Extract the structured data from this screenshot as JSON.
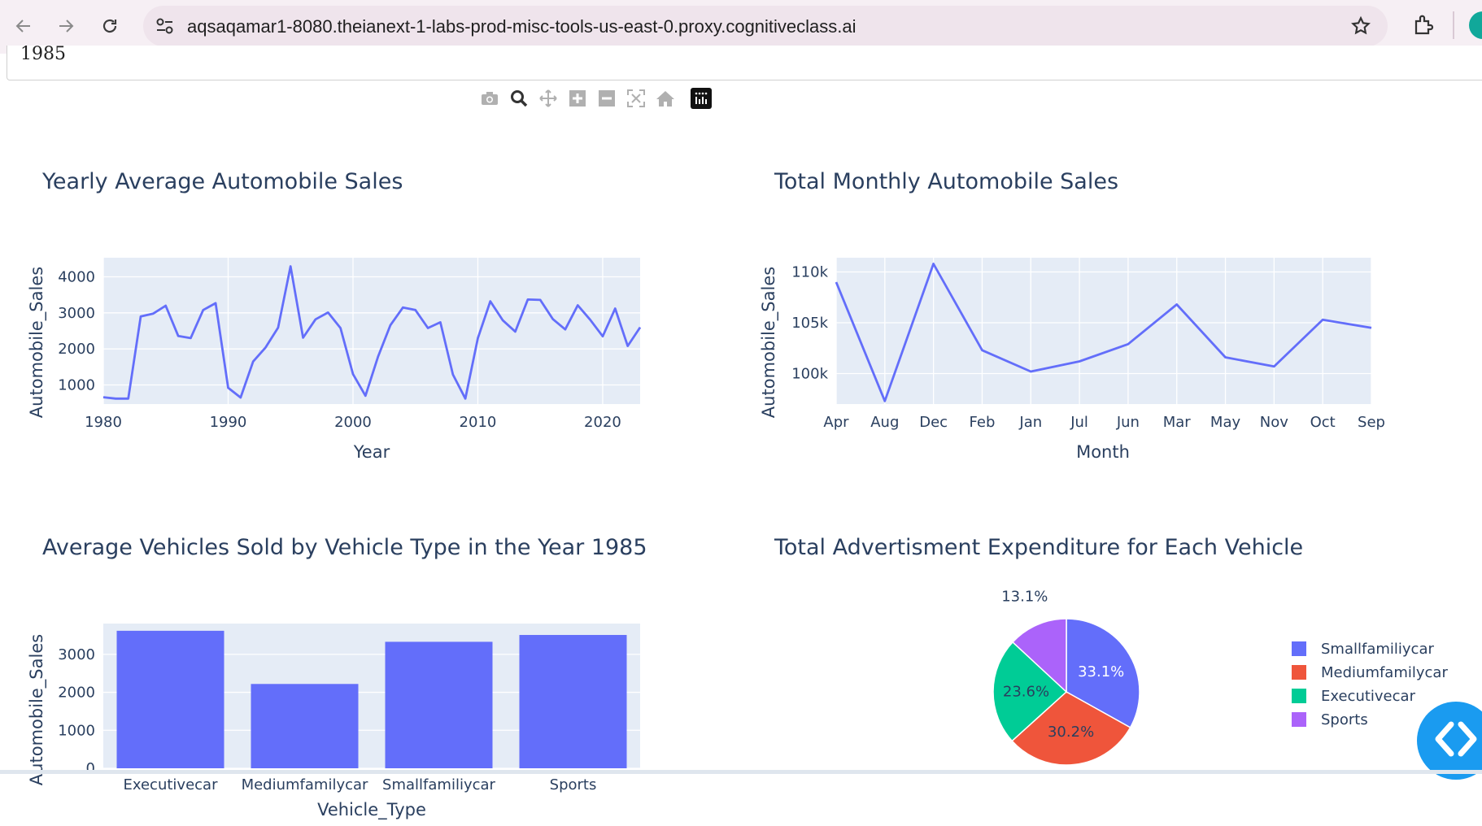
{
  "browser": {
    "url": "aqsaqamar1-8080.theianext-1-labs-prod-misc-tools-us-east-0.proxy.cognitiveclass.ai",
    "icons": [
      "back-arrow-icon",
      "forward-arrow-icon",
      "reload-icon",
      "site-settings-icon",
      "bookmark-star-icon",
      "extensions-icon"
    ]
  },
  "year_input": {
    "value": "1985"
  },
  "modebar": {
    "icons": [
      "camera-icon",
      "zoom-icon",
      "pan-icon",
      "zoom-in-icon",
      "zoom-out-icon",
      "autoscale-icon",
      "reset-axes-icon",
      "plotly-logo-icon"
    ]
  },
  "colors": {
    "line": "#636efa",
    "plot_bg": "#e5ecf6",
    "text": "#2a3f5f",
    "pie": [
      "#636efa",
      "#ef553b",
      "#00cc96",
      "#ab63fa"
    ],
    "fab": "#1a9bf0"
  },
  "chart_data": [
    {
      "id": "yearly",
      "type": "line",
      "title": "Yearly Average Automobile Sales",
      "xlabel": "Year",
      "ylabel": "Automobile_Sales",
      "x": [
        1980,
        1981,
        1982,
        1983,
        1984,
        1985,
        1986,
        1987,
        1988,
        1989,
        1990,
        1991,
        1992,
        1993,
        1994,
        1995,
        1996,
        1997,
        1998,
        1999,
        2000,
        2001,
        2002,
        2003,
        2004,
        2005,
        2006,
        2007,
        2008,
        2009,
        2010,
        2011,
        2012,
        2013,
        2014,
        2015,
        2016,
        2017,
        2018,
        2019,
        2020,
        2021,
        2022,
        2023
      ],
      "y": [
        660,
        620,
        620,
        2900,
        2980,
        3200,
        2360,
        2300,
        3080,
        3270,
        920,
        650,
        1650,
        2040,
        2590,
        4290,
        2310,
        2820,
        3010,
        2580,
        1300,
        700,
        1780,
        2660,
        3150,
        3080,
        2580,
        2740,
        1290,
        620,
        2300,
        3320,
        2790,
        2480,
        3370,
        3360,
        2830,
        2540,
        3210,
        2810,
        2350,
        3120,
        2080,
        2600
      ],
      "xlim": [
        1980,
        2023
      ],
      "ylim": [
        470,
        4530
      ],
      "xticks": [
        1980,
        1990,
        2000,
        2010,
        2020
      ],
      "yticks": [
        1000,
        2000,
        3000,
        4000
      ],
      "ytick_labels": [
        "1000",
        "2000",
        "3000",
        "4000"
      ],
      "grid": true
    },
    {
      "id": "monthly",
      "type": "line",
      "title": "Total Monthly Automobile Sales",
      "xlabel": "Month",
      "ylabel": "Automobile_Sales",
      "categories": [
        "Apr",
        "Aug",
        "Dec",
        "Feb",
        "Jan",
        "Jul",
        "Jun",
        "Mar",
        "May",
        "Nov",
        "Oct",
        "Sep"
      ],
      "values": [
        109000,
        97300,
        110800,
        102300,
        100200,
        101200,
        102900,
        106800,
        101600,
        100700,
        105300,
        104500
      ],
      "ylim": [
        97000,
        111400
      ],
      "yticks": [
        100000,
        105000,
        110000
      ],
      "ytick_labels": [
        "100k",
        "105k",
        "110k"
      ],
      "grid": true
    },
    {
      "id": "vehicle-type",
      "type": "bar",
      "title": "Average Vehicles Sold by Vehicle Type in the Year 1985",
      "xlabel": "Vehicle_Type",
      "ylabel": "Automobile_Sales",
      "categories": [
        "Executivecar",
        "Mediumfamilycar",
        "Smallfamiliycar",
        "Sports"
      ],
      "values": [
        3620,
        2220,
        3330,
        3510
      ],
      "ylim": [
        0,
        3810
      ],
      "yticks": [
        0,
        1000,
        2000,
        3000
      ],
      "ytick_labels": [
        "0",
        "1000",
        "2000",
        "3000"
      ],
      "grid": true
    },
    {
      "id": "ad-expenditure",
      "type": "pie",
      "title": "Total Advertisment Expenditure for Each Vehicle",
      "labels": [
        "Smallfamiliycar",
        "Mediumfamilycar",
        "Executivecar",
        "Sports"
      ],
      "values": [
        33.1,
        30.2,
        23.6,
        13.1
      ],
      "value_labels": [
        "33.1%",
        "30.2%",
        "23.6%",
        "13.1%"
      ],
      "legend": "right"
    }
  ]
}
